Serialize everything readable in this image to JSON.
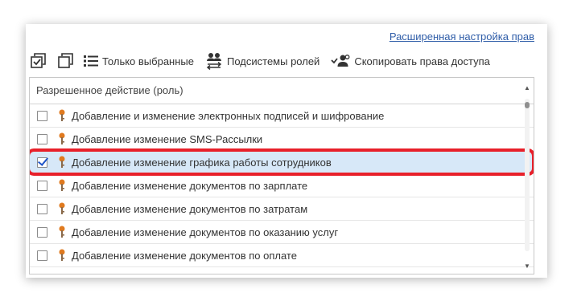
{
  "header": {
    "advanced_link": "Расширенная настройка прав"
  },
  "toolbar": {
    "check_all_icon": "check-all-icon",
    "copy_icon": "copy-icon",
    "only_selected_label": "Только выбранные",
    "subsystems_label": "Подсистемы ролей",
    "copy_access_label": "Скопировать права доступа"
  },
  "table": {
    "column_header": "Разрешенное действие (роль)",
    "rows": [
      {
        "label": "Добавление и изменение электронных подписей и шифрование",
        "checked": false
      },
      {
        "label": "Добавление изменение SMS-Рассылки",
        "checked": false
      },
      {
        "label": "Добавление изменение графика работы сотрудников",
        "checked": true
      },
      {
        "label": "Добавление изменение документов по зарплате",
        "checked": false
      },
      {
        "label": "Добавление изменение документов по затратам",
        "checked": false
      },
      {
        "label": "Добавление изменение документов по оказанию услуг",
        "checked": false
      },
      {
        "label": "Добавление изменение документов по оплате",
        "checked": false
      }
    ]
  },
  "colors": {
    "accent": "#2f5da8",
    "selected_row": "#d7e8f8",
    "highlight": "#e8202a",
    "key_icon": "#e07a1f"
  }
}
